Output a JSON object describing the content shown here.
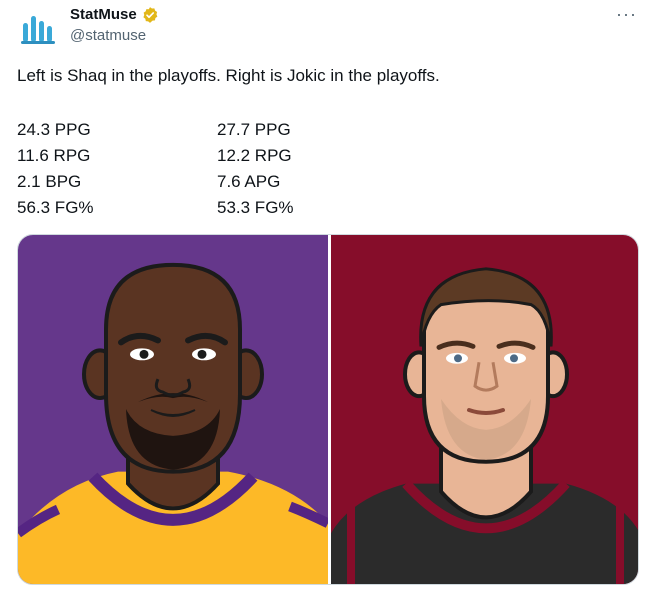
{
  "account": {
    "display_name": "StatMuse",
    "handle": "@statmuse",
    "avatar_icon": "statmuse-logo-icon",
    "verified_icon": "verified-badge-icon",
    "verified_color": "#e2b719"
  },
  "menu": {
    "more_label": "···"
  },
  "tweet": {
    "text": "Left is Shaq in the playoffs. Right is Jokic in the playoffs.",
    "stats": [
      {
        "left": "24.3 PPG",
        "right": "27.7 PPG"
      },
      {
        "left": "11.6 RPG",
        "right": "12.2 RPG"
      },
      {
        "left": "2.1 BPG",
        "right": "7.6 APG"
      },
      {
        "left": "56.3 FG%",
        "right": "53.3 FG%"
      }
    ]
  },
  "media": {
    "left_panel": {
      "background": "#65378b",
      "jersey": "#fdb927",
      "trim": "#552583"
    },
    "right_panel": {
      "background": "#860d2a",
      "jersey": "#2b2b2b",
      "trim": "#860d2a"
    }
  }
}
